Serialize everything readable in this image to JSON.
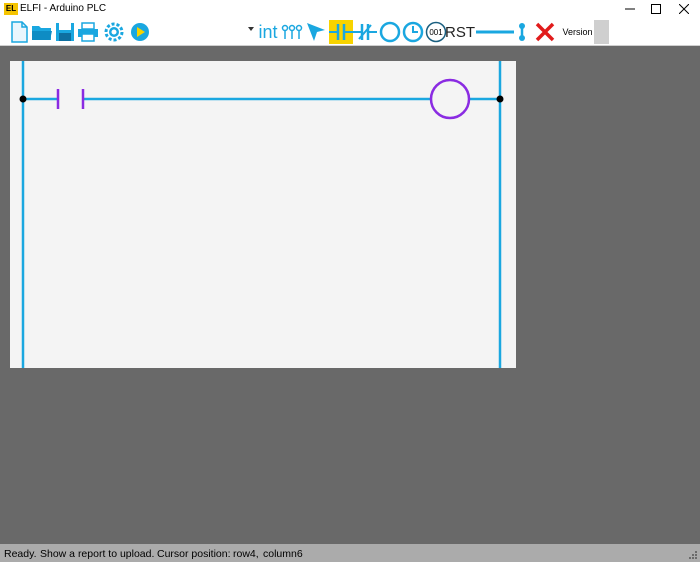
{
  "window": {
    "icon_text": "EL",
    "title": "ELFI - Arduino PLC"
  },
  "toolbar": {
    "tools": [
      "new-file-icon",
      "open-folder-icon",
      "save-icon",
      "print-icon",
      "settings-gear-icon",
      "run-icon",
      "select-arrow-icon",
      "contact-no-icon",
      "contact-nc-icon",
      "coil-icon",
      "timer-icon",
      "counter-icon",
      "wire-icon",
      "delete-icon"
    ],
    "program_select_value": "",
    "int_label": "int",
    "counter_label": "001",
    "rst_label": "RST",
    "version_label": "Version"
  },
  "ladder": {
    "rung_elements": [
      "normally-open-contact",
      "output-coil"
    ]
  },
  "colors": {
    "rail": "#1aa7e0",
    "element": "#8a2be2",
    "highlight": "#f7d300",
    "background": "#696969",
    "canvas": "#f4f4f4"
  },
  "status": {
    "ready": "Ready.",
    "message": "Show a report to upload.",
    "cursor_label": "Cursor position:",
    "row": "row4,",
    "column": "column6"
  }
}
